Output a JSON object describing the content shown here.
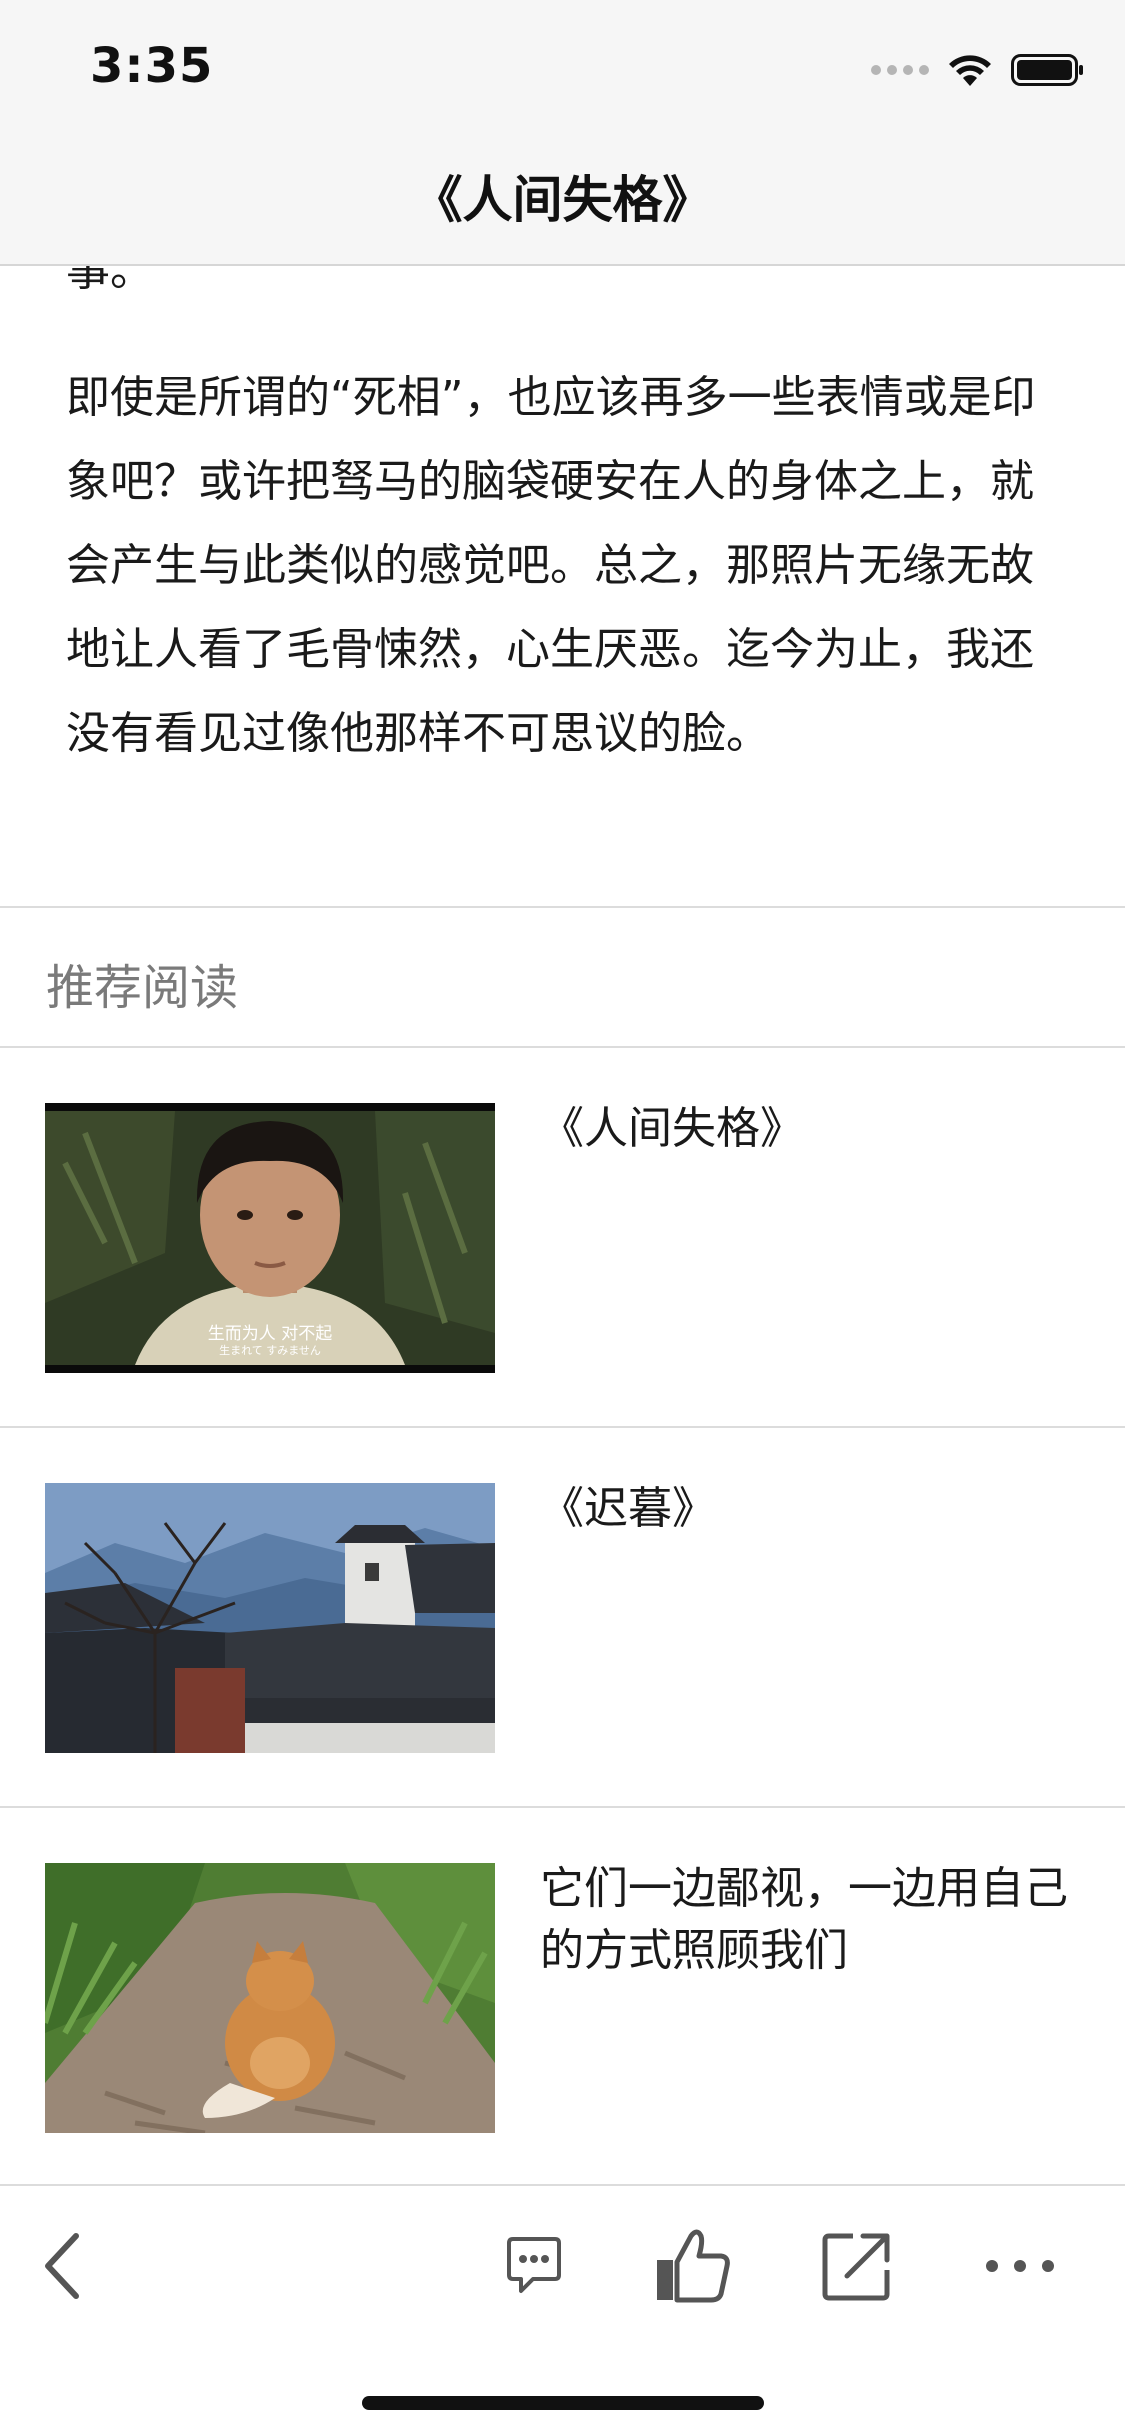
{
  "status_bar": {
    "time": "3:35",
    "icons": [
      "signal-dots-icon",
      "wifi-icon",
      "battery-icon"
    ]
  },
  "nav": {
    "title": "《人间失格》"
  },
  "article": {
    "tail_text": "事。",
    "paragraph": "即使是所谓的“死相”，也应该再多一些表情或是印象吧？或许把驽马的脑袋硬安在人的身体之上，就会产生与此类似的感觉吧。总之，那照片无缘无故地让人看了毛骨悚然，心生厌恶。迄今为止，我还没有看见过像他那样不可思议的脸。"
  },
  "recommended": {
    "heading": "推荐阅读",
    "items": [
      {
        "title": "《人间失格》",
        "subtitle_line1": "生而为人 对不起",
        "subtitle_line2": "生まれて すみません"
      },
      {
        "title": "《迟暮》"
      },
      {
        "title": "它们一边鄙视，一边用自己的方式照顾我们"
      }
    ]
  },
  "toolbar": {
    "buttons": [
      "back-icon",
      "comment-icon",
      "like-icon",
      "share-icon",
      "more-icon"
    ]
  },
  "colors": {
    "topbar_bg": "#f6f6f6",
    "divider": "#dcdcdc",
    "section_heading": "#7a7a7a",
    "icon_gray": "#555555"
  }
}
